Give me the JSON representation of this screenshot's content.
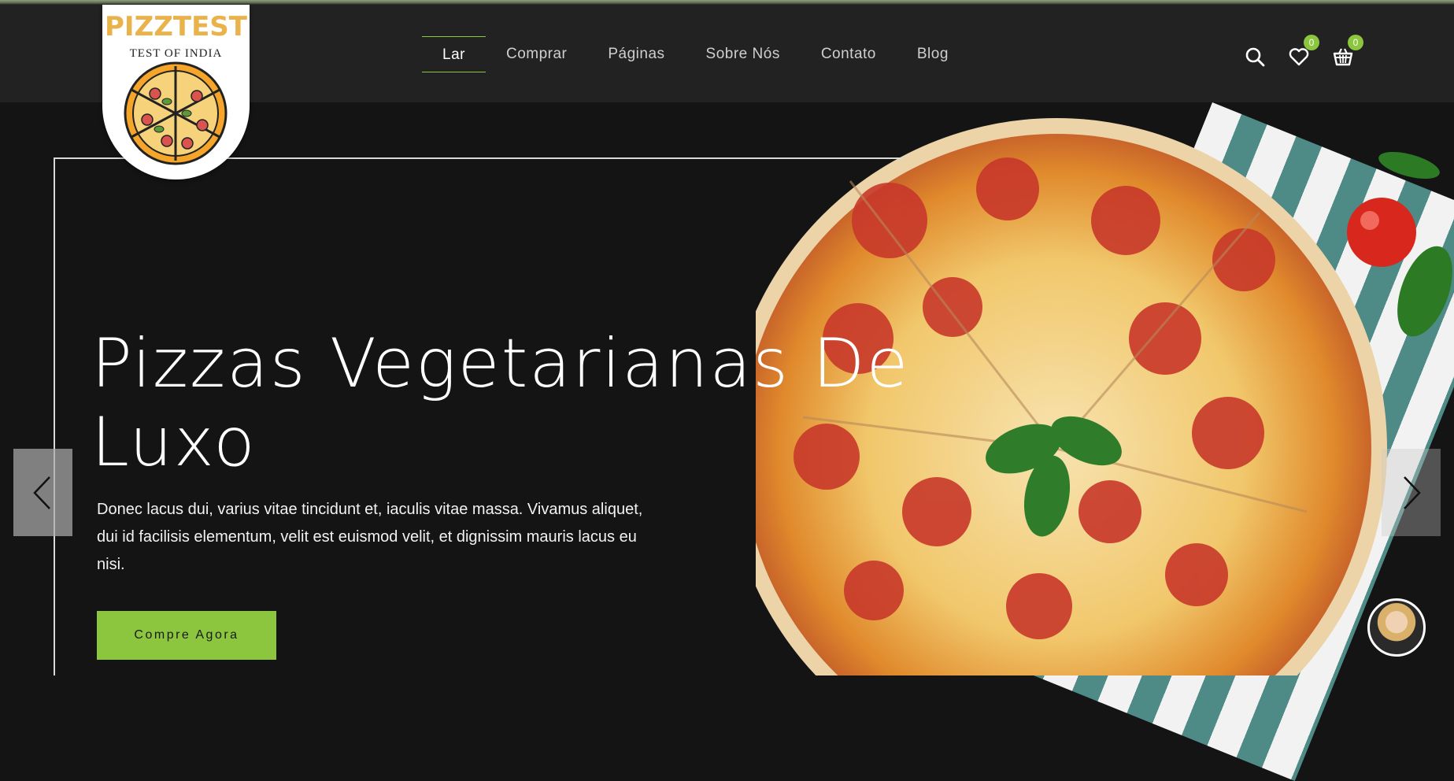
{
  "logo": {
    "title": "PIZZTEST",
    "subtitle": "TEST OF INDIA",
    "icon": "pizza-logo"
  },
  "nav": {
    "items": [
      {
        "label": "Lar",
        "active": true
      },
      {
        "label": "Comprar",
        "active": false
      },
      {
        "label": "Páginas",
        "active": false
      },
      {
        "label": "Sobre Nós",
        "active": false
      },
      {
        "label": "Contato",
        "active": false
      },
      {
        "label": "Blog",
        "active": false
      }
    ]
  },
  "header_icons": {
    "search": "search-icon",
    "wishlist": {
      "icon": "heart-icon",
      "count": "0"
    },
    "cart": {
      "icon": "basket-icon",
      "count": "0"
    }
  },
  "hero": {
    "title_line1": "Pizzas Vegetarianas De",
    "title_line2": "Luxo",
    "text": "Donec lacus dui, varius vitae tincidunt et, iaculis vitae massa. Vivamus aliquet, dui id facilisis elementum, velit est euismod velit, et dignissim mauris lacus eu nisi.",
    "cta_label": "Compre Agora"
  },
  "colors": {
    "accent": "#8cc63f",
    "header_bg": "#222222",
    "hero_bg": "#141414"
  },
  "slider": {
    "prev_icon": "chevron-left-icon",
    "next_icon": "chevron-right-icon"
  },
  "chat": {
    "icon": "support-avatar"
  }
}
